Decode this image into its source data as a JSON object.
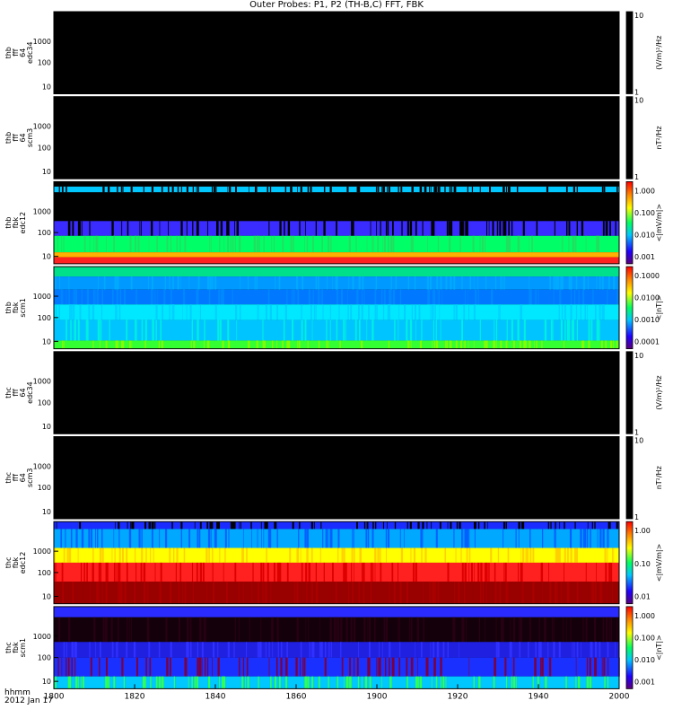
{
  "title": "Outer Probes: P1, P2 (TH-B,C) FFT, FBK",
  "footer": {
    "line1": "hhmm",
    "line2": "2012 Jan 17"
  },
  "colors": {
    "frame": "#000000",
    "background": "#ffffff",
    "empty_panel": "#000000"
  },
  "chart_data": {
    "type": "heatmap",
    "x": {
      "ticks": [
        "1800",
        "1820",
        "1840",
        "1860",
        "1900",
        "1920",
        "1940",
        "2000"
      ],
      "range": [
        "1800",
        "2000"
      ]
    },
    "panels": [
      {
        "label": [
          "thb",
          "fff",
          "64",
          "edc34"
        ],
        "yticks": [
          "1000",
          "100",
          "10"
        ],
        "colorbar": {
          "label": "(V/m)²/Hz",
          "ticks": [
            "10",
            "1"
          ]
        },
        "bands": []
      },
      {
        "label": [
          "thb",
          "fff",
          "64",
          "scm3"
        ],
        "yticks": [
          "1000",
          "100",
          "10"
        ],
        "colorbar": {
          "label": "nT²/Hz",
          "ticks": [
            "10",
            "1"
          ]
        },
        "bands": []
      },
      {
        "label": [
          "thb",
          "fbk",
          "edc12"
        ],
        "yticks": [
          "1000",
          "100",
          "10"
        ],
        "colorbar": {
          "label": "<|mV/m|>",
          "ticks": [
            "1.000",
            "0.100",
            "0.010",
            "0.001"
          ]
        },
        "bands": [
          {
            "y0": 0.0,
            "y1": 0.06,
            "color": "#000000"
          },
          {
            "y0": 0.06,
            "y1": 0.13,
            "color": "#00c8ff",
            "gaps": "#000000"
          },
          {
            "y0": 0.13,
            "y1": 0.48,
            "color": "#000000"
          },
          {
            "y0": 0.48,
            "y1": 0.66,
            "color": "#3a2cff",
            "gaps": "#000000"
          },
          {
            "y0": 0.66,
            "y1": 0.86,
            "color": "#00ff66",
            "gaps": "#20e060"
          },
          {
            "y0": 0.86,
            "y1": 0.92,
            "color": "#ffb000"
          },
          {
            "y0": 0.92,
            "y1": 1.0,
            "color": "#ff2020"
          }
        ]
      },
      {
        "label": [
          "thb",
          "fbk",
          "scm1"
        ],
        "yticks": [
          "1000",
          "100",
          "10"
        ],
        "colorbar": {
          "label": "<|nT|>",
          "ticks": [
            "0.1000",
            "0.0100",
            "0.0010",
            "0.0001"
          ]
        },
        "bands": [
          {
            "y0": 0.0,
            "y1": 0.12,
            "color": "#00e08a"
          },
          {
            "y0": 0.12,
            "y1": 0.28,
            "color": "#0099ff",
            "gaps": "#00aaff"
          },
          {
            "y0": 0.28,
            "y1": 0.46,
            "color": "#0078ff",
            "gaps": "#0088ff"
          },
          {
            "y0": 0.46,
            "y1": 0.65,
            "color": "#00e8ff",
            "gaps": "#00d0ff"
          },
          {
            "y0": 0.65,
            "y1": 0.9,
            "color": "#00c4ff",
            "gaps": "#00f0e0"
          },
          {
            "y0": 0.9,
            "y1": 1.0,
            "color": "#33ff33",
            "gaps": "#88ff00"
          }
        ]
      },
      {
        "label": [
          "thc",
          "fff",
          "64",
          "edc34"
        ],
        "yticks": [
          "1000",
          "100",
          "10"
        ],
        "colorbar": {
          "label": "(V/m)²/Hz",
          "ticks": [
            "10",
            "1"
          ]
        },
        "bands": []
      },
      {
        "label": [
          "thc",
          "fff",
          "64",
          "scm3"
        ],
        "yticks": [
          "1000",
          "100",
          "10"
        ],
        "colorbar": {
          "label": "nT²/Hz",
          "ticks": [
            "10",
            "1"
          ]
        },
        "bands": []
      },
      {
        "label": [
          "thc",
          "fbk",
          "edc12"
        ],
        "yticks": [
          "1000",
          "100",
          "10"
        ],
        "colorbar": {
          "label": "<|mV/m|>",
          "ticks": [
            "1.00",
            "0.10",
            "0.01"
          ]
        },
        "bands": [
          {
            "y0": 0.0,
            "y1": 0.09,
            "color": "#1a2cff",
            "gaps": "#000000"
          },
          {
            "y0": 0.09,
            "y1": 0.32,
            "color": "#00a8ff",
            "gaps": "#0060ff"
          },
          {
            "y0": 0.32,
            "y1": 0.5,
            "color": "#ffff00",
            "gaps": "#ffd000"
          },
          {
            "y0": 0.5,
            "y1": 0.73,
            "color": "#ff2020",
            "gaps": "#dd0000"
          },
          {
            "y0": 0.73,
            "y1": 1.0,
            "color": "#990000",
            "gaps": "#aa0000"
          }
        ]
      },
      {
        "label": [
          "thc",
          "fbk",
          "scm1"
        ],
        "yticks": [
          "1000",
          "100",
          "10"
        ],
        "colorbar": {
          "label": "<|nT|>",
          "ticks": [
            "1.000",
            "0.100",
            "0.010",
            "0.001"
          ]
        },
        "bands": [
          {
            "y0": 0.0,
            "y1": 0.13,
            "color": "#2a2cff"
          },
          {
            "y0": 0.13,
            "y1": 0.43,
            "color": "#14000a",
            "gaps": "#280014"
          },
          {
            "y0": 0.43,
            "y1": 0.62,
            "color": "#2020e0",
            "gaps": "#3030ff"
          },
          {
            "y0": 0.62,
            "y1": 0.85,
            "color": "#1a30ff",
            "gaps": "#7a0040"
          },
          {
            "y0": 0.85,
            "y1": 1.0,
            "color": "#00c8ff",
            "gaps": "#30ff50"
          }
        ]
      }
    ]
  }
}
